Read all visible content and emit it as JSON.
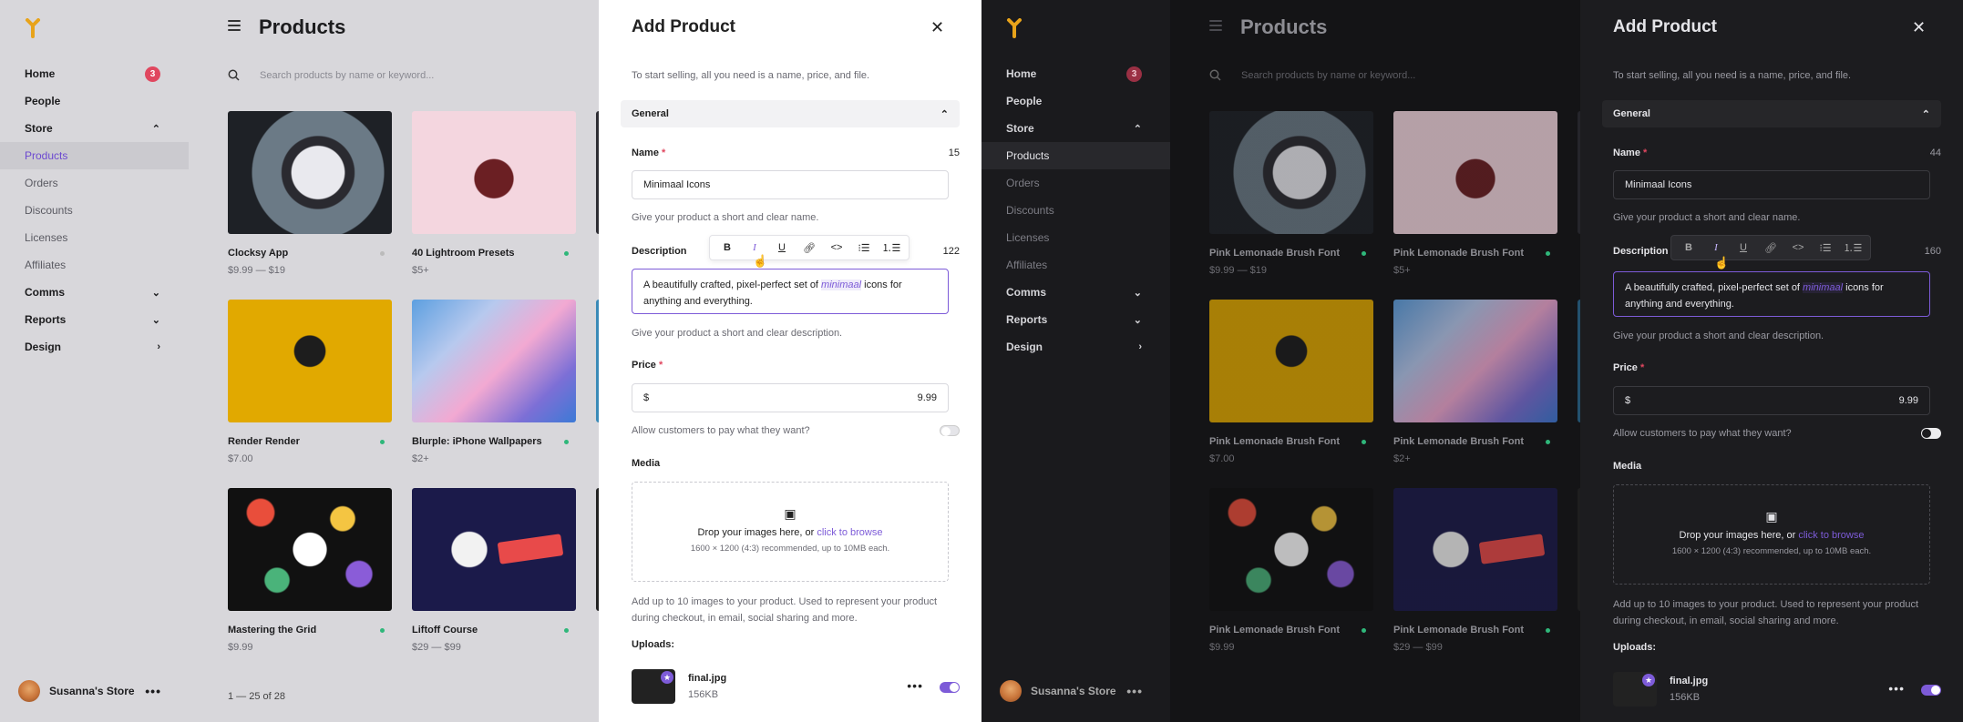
{
  "light": {
    "nav": {
      "home": "Home",
      "home_badge": "3",
      "people": "People",
      "store": "Store",
      "products": "Products",
      "orders": "Orders",
      "discounts": "Discounts",
      "licenses": "Licenses",
      "affiliates": "Affiliates",
      "comms": "Comms",
      "reports": "Reports",
      "design": "Design"
    },
    "store_name": "Susanna's Store",
    "page_title": "Products",
    "search_placeholder": "Search products by name or keyword...",
    "products": [
      {
        "name": "Clocksy App",
        "price": "$9.99 — $19"
      },
      {
        "name": "40 Lightroom Presets",
        "price": "$5+"
      },
      {
        "name": "Render Render",
        "price": "$7.00"
      },
      {
        "name": "Blurple: iPhone Wallpapers",
        "price": "$2+"
      },
      {
        "name": "Mastering the Grid",
        "price": "$9.99"
      },
      {
        "name": "Liftoff Course",
        "price": "$29 — $99"
      }
    ],
    "pagination": "1 — 25 of 28",
    "panel": {
      "title": "Add Product",
      "subtitle": "To start selling, all you need is a name, price, and file.",
      "section": "General",
      "name_label": "Name",
      "name_count": "15",
      "name_value": "Minimaal Icons",
      "name_help": "Give your product a short and clear name.",
      "desc_label": "Description",
      "desc_count": "122",
      "desc_before": "A beautifully crafted, pixel-perfect set of ",
      "desc_highlight": "minimaal",
      "desc_after": " icons for anything and everything.",
      "desc_help": "Give your product a short and clear description.",
      "price_label": "Price",
      "currency": "$",
      "price_value": "9.99",
      "pwyw": "Allow customers to pay what they want?",
      "media_label": "Media",
      "drop_text": "Drop your images here, or ",
      "drop_link": "click to browse",
      "drop_hint": "1600 × 1200 (4:3) recommended, up to 10MB each.",
      "media_help": "Add up to 10 images to your product. Used to represent your product during checkout, in email, social sharing and more.",
      "uploads_label": "Uploads:",
      "upload_name": "final.jpg",
      "upload_size": "156KB"
    }
  },
  "dark": {
    "nav": {
      "home": "Home",
      "home_badge": "3",
      "people": "People",
      "store": "Store",
      "products": "Products",
      "orders": "Orders",
      "discounts": "Discounts",
      "licenses": "Licenses",
      "affiliates": "Affiliates",
      "comms": "Comms",
      "reports": "Reports",
      "design": "Design"
    },
    "store_name": "Susanna's Store",
    "page_title": "Products",
    "search_placeholder": "Search products by name or keyword...",
    "products": [
      {
        "name": "Pink Lemonade Brush Font",
        "price": "$9.99 — $19"
      },
      {
        "name": "Pink Lemonade Brush Font",
        "price": "$5+"
      },
      {
        "name": "Pink Lemonade Brush Font",
        "price": "$7.00"
      },
      {
        "name": "Pink Lemonade Brush Font",
        "price": "$2+"
      },
      {
        "name": "Pink Lemonade Brush Font",
        "price": "$9.99"
      },
      {
        "name": "Pink Lemonade Brush Font",
        "price": "$29 — $99"
      }
    ],
    "panel": {
      "title": "Add Product",
      "subtitle": "To start selling, all you need is a name, price, and file.",
      "section": "General",
      "name_label": "Name",
      "name_count": "44",
      "name_value": "Minimaal Icons",
      "name_help": "Give your product a short and clear name.",
      "desc_label": "Description",
      "desc_count": "160",
      "desc_before": "A beautifully crafted, pixel-perfect set of ",
      "desc_highlight": "minimaal",
      "desc_after": " icons for anything and everything.",
      "desc_help": "Give your product a short and clear description.",
      "price_label": "Price",
      "currency": "$",
      "price_value": "9.99",
      "pwyw": "Allow customers to pay what they want?",
      "media_label": "Media",
      "drop_text": "Drop your images here, or ",
      "drop_link": "click to browse",
      "drop_hint": "1600 × 1200 (4:3) recommended, up to 10MB each.",
      "media_help": "Add up to 10 images to your product. Used to represent your product during checkout, in email, social sharing and more.",
      "uploads_label": "Uploads:",
      "upload_name": "final.jpg",
      "upload_size": "156KB"
    }
  },
  "colors": {
    "accent": "#7d5bd8",
    "badge": "#e0475f",
    "status_green": "#2fb77a"
  }
}
